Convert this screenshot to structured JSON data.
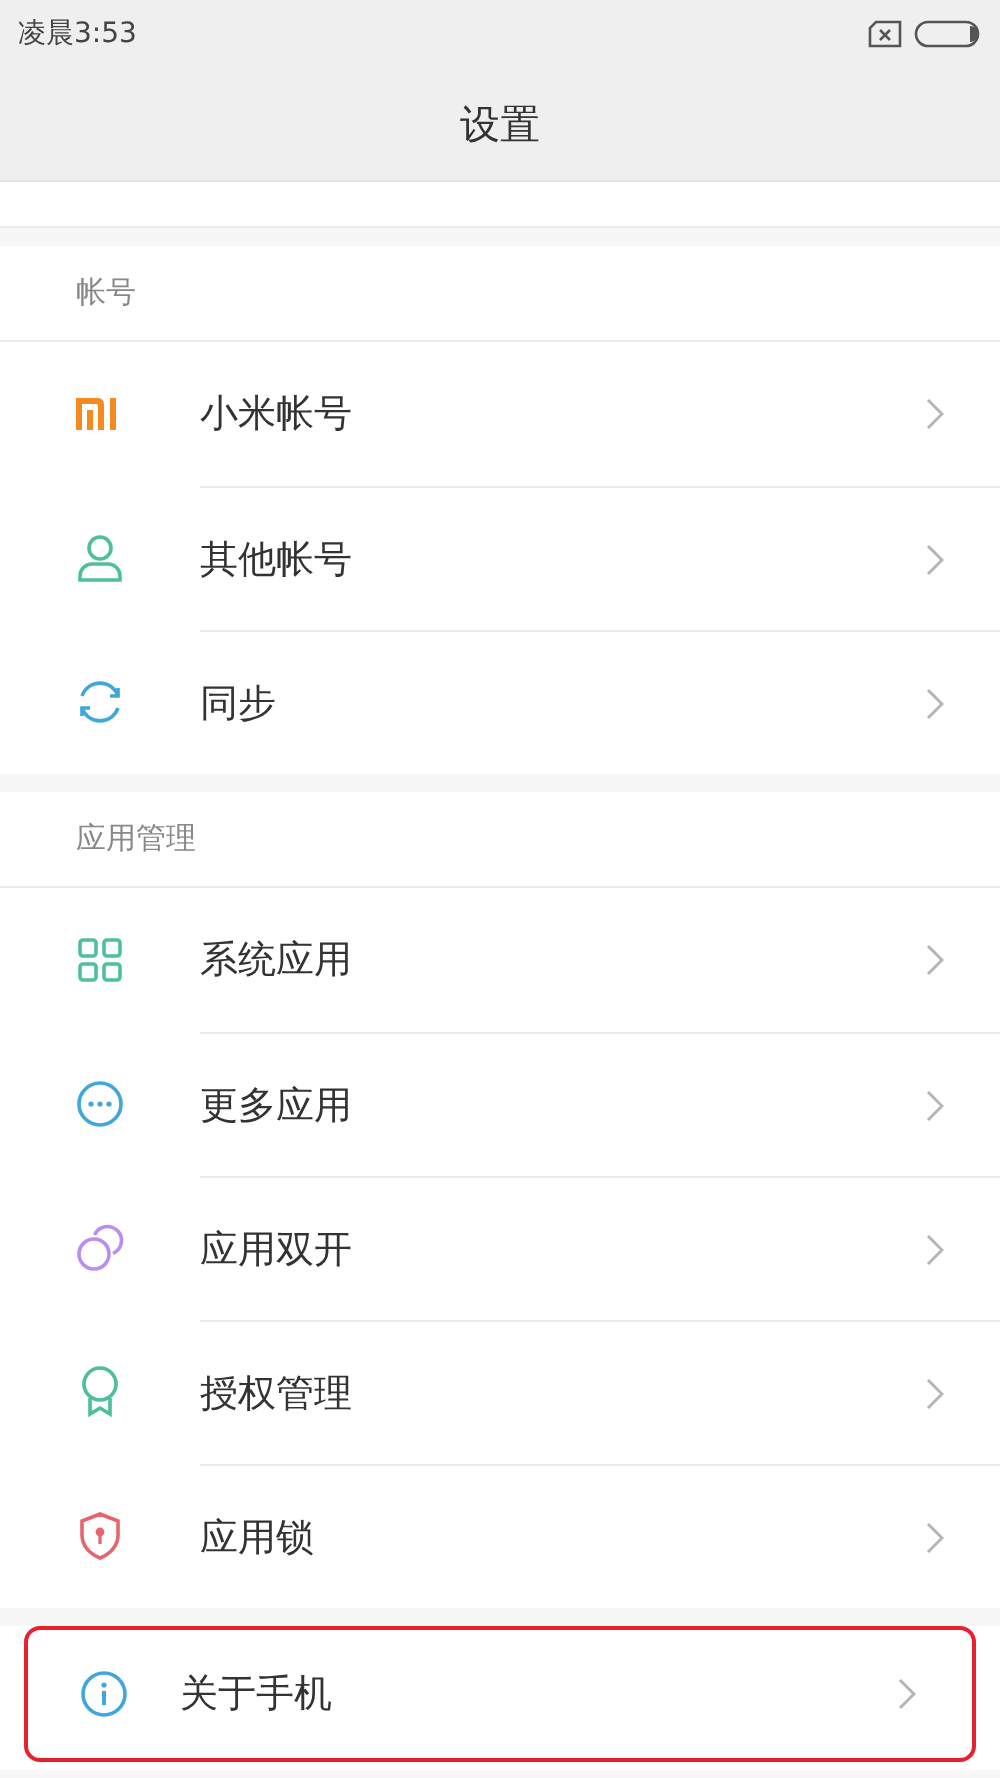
{
  "status_bar": {
    "time": "凌晨3:53"
  },
  "title": "设置",
  "sections": [
    {
      "header": "帐号",
      "items": [
        {
          "label": "小米帐号",
          "highlighted": false
        },
        {
          "label": "其他帐号",
          "highlighted": false
        },
        {
          "label": "同步",
          "highlighted": false
        }
      ]
    },
    {
      "header": "应用管理",
      "items": [
        {
          "label": "系统应用",
          "highlighted": false
        },
        {
          "label": "更多应用",
          "highlighted": false
        },
        {
          "label": "应用双开",
          "highlighted": false
        },
        {
          "label": "授权管理",
          "highlighted": false
        },
        {
          "label": "应用锁",
          "highlighted": false
        }
      ]
    },
    {
      "items": [
        {
          "label": "关于手机",
          "highlighted": true
        }
      ]
    }
  ]
}
